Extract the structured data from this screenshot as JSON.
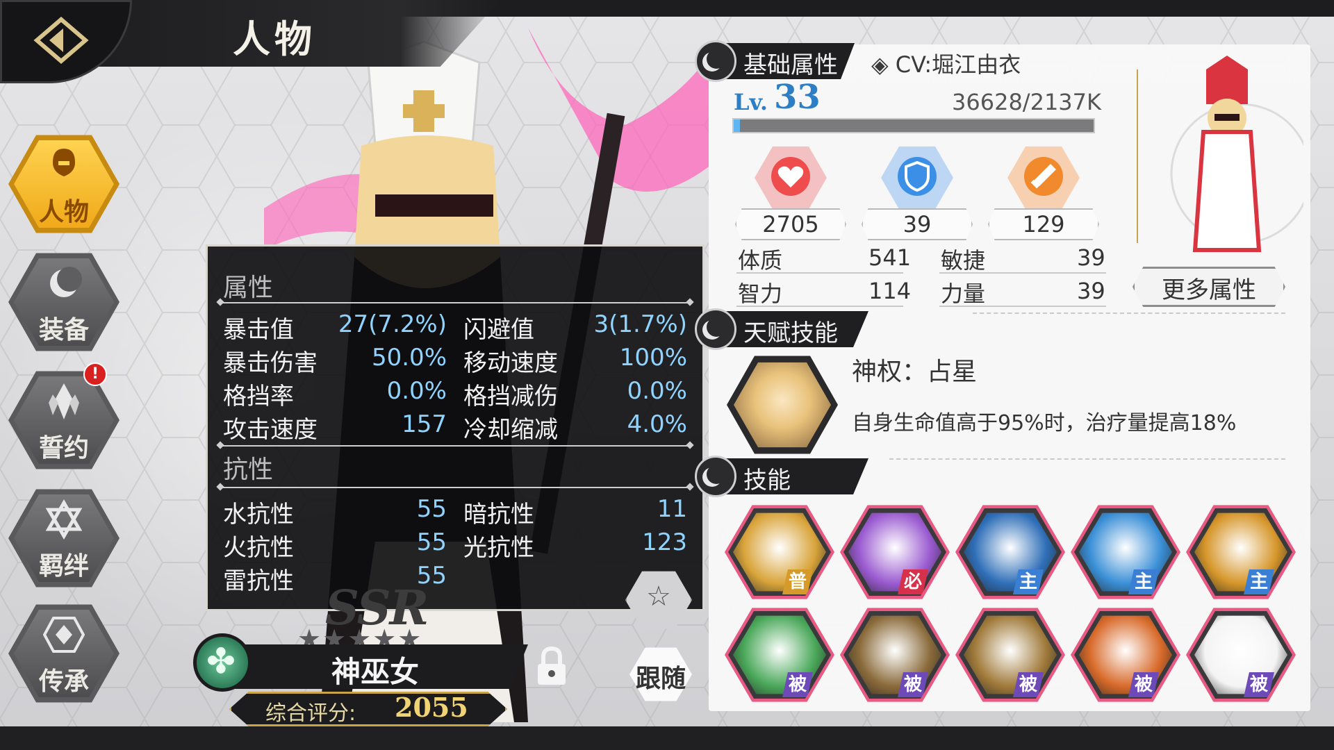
{
  "header": {
    "title": "人物",
    "back_icon": "back-arrow-icon"
  },
  "nav": {
    "items": [
      {
        "label": "人物",
        "icon": "character-icon",
        "active": true
      },
      {
        "label": "装备",
        "icon": "moon-equip-icon",
        "active": false
      },
      {
        "label": "誓约",
        "icon": "crystal-oath-icon",
        "active": false,
        "alert": "!"
      },
      {
        "label": "羁绊",
        "icon": "hexagram-bond-icon",
        "active": false
      },
      {
        "label": "传承",
        "icon": "inherit-emblem-icon",
        "active": false
      }
    ]
  },
  "attr_popup": {
    "section1_title": "属性",
    "attrs": [
      {
        "k": "暴击值",
        "v": "27(7.2%)"
      },
      {
        "k": "闪避值",
        "v": "3(1.7%)"
      },
      {
        "k": "暴击伤害",
        "v": "50.0%"
      },
      {
        "k": "移动速度",
        "v": "100%"
      },
      {
        "k": "格挡率",
        "v": "0.0%"
      },
      {
        "k": "格挡减伤",
        "v": "0.0%"
      },
      {
        "k": "攻击速度",
        "v": "157"
      },
      {
        "k": "冷却缩减",
        "v": "4.0%"
      }
    ],
    "section2_title": "抗性",
    "resist": [
      {
        "k": "水抗性",
        "v": "55"
      },
      {
        "k": "暗抗性",
        "v": "11"
      },
      {
        "k": "火抗性",
        "v": "55"
      },
      {
        "k": "光抗性",
        "v": "123"
      },
      {
        "k": "雷抗性",
        "v": "55"
      }
    ]
  },
  "character": {
    "rarity": "SSR",
    "stars": "★★★★★",
    "name": "神巫女",
    "score_label": "综合评分:",
    "score": "2055",
    "follow_label": "跟随"
  },
  "basic": {
    "tag": "基础属性",
    "cv": "◈ CV:堀江由衣",
    "lv_label": "Lv.",
    "lv": "33",
    "exp": "36628/2137K",
    "exp_fraction": 0.017,
    "hp": "2705",
    "def": "39",
    "atk": "129",
    "stats": [
      {
        "k": "体质",
        "v": "541"
      },
      {
        "k": "敏捷",
        "v": "39"
      },
      {
        "k": "智力",
        "v": "114"
      },
      {
        "k": "力量",
        "v": "39"
      }
    ],
    "more_label": "更多属性"
  },
  "talent": {
    "tag": "天赋技能",
    "name": "神权：占星",
    "desc": "自身生命值高于95%时，治疗量提高18%"
  },
  "skills": {
    "tag": "技能",
    "items": [
      {
        "tag": "普",
        "kind": "basic",
        "color": "#d9a43a"
      },
      {
        "tag": "必",
        "kind": "ult",
        "color": "#9a5ad0"
      },
      {
        "tag": "主",
        "kind": "main",
        "color": "#2f6fb8"
      },
      {
        "tag": "主",
        "kind": "main",
        "color": "#3a8fd6"
      },
      {
        "tag": "主",
        "kind": "main",
        "color": "#d6962a"
      },
      {
        "tag": "被",
        "kind": "passive",
        "color": "#4aa85a"
      },
      {
        "tag": "被",
        "kind": "passive",
        "color": "#8a6a3a"
      },
      {
        "tag": "被",
        "kind": "passive",
        "color": "#a07a3a"
      },
      {
        "tag": "被",
        "kind": "passive",
        "color": "#d86a2a"
      },
      {
        "tag": "被",
        "kind": "passive",
        "color": "#f4f4f4"
      }
    ]
  },
  "colors": {
    "accent_blue": "#2c7fc5",
    "hp_red": "#ef4d4d",
    "def_blue": "#3c8fe6",
    "atk_orange": "#f08a2c"
  }
}
